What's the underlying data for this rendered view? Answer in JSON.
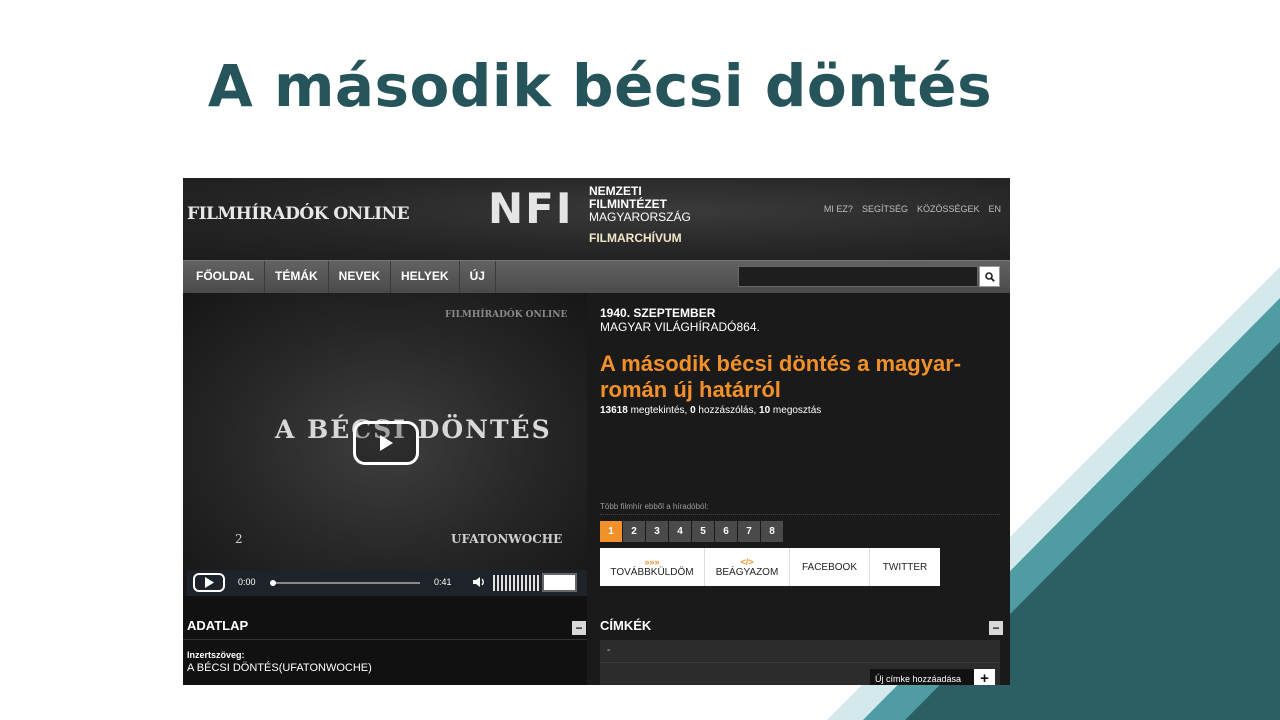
{
  "slide": {
    "title": "A második bécsi döntés"
  },
  "header": {
    "brand": "FILMHÍRADÓK ONLINE",
    "nfi_logo": "NFI",
    "nfi_line1": "NEMZETI",
    "nfi_line2": "FILMINTÉZET",
    "nfi_line3": "MAGYARORSZÁG",
    "nfi_line4": "FILMARCHÍVUM",
    "links": [
      "MI EZ?",
      "SEGÍTSÉG",
      "KÖZÖSSÉGEK",
      "EN"
    ]
  },
  "nav": {
    "items": [
      "FŐOLDAL",
      "TÉMÁK",
      "NEVEK",
      "HELYEK",
      "ÚJ"
    ],
    "search_placeholder": ""
  },
  "video": {
    "watermark": "FILMHÍRADÓK ONLINE",
    "frame_title": "A BÉCSI DÖNTÉS",
    "frame_number": "2",
    "frame_credit": "UFATONWOCHE",
    "time_current": "0:00",
    "time_total": "0:41",
    "progress": 0
  },
  "info": {
    "date": "1940. SZEPTEMBER",
    "newsreel": "MAGYAR VILÁGHÍRADÓ864.",
    "title": "A második bécsi döntés a magyar-román új határról",
    "views": "13618",
    "views_label": "megtekintés,",
    "comments": "0",
    "comments_label": "hozzászólás,",
    "shares": "10",
    "shares_label": "megosztás",
    "more_label": "Több filmhír ebből a híradóból:",
    "pages": [
      "1",
      "2",
      "3",
      "4",
      "5",
      "6",
      "7",
      "8"
    ],
    "active_page": "1",
    "share_buttons": {
      "forward": "TOVÁBBKÜLDÖM",
      "embed": "BEÁGYAZOM",
      "facebook": "FACEBOOK",
      "twitter": "TWITTER"
    },
    "accent_color": "#f2912a"
  },
  "adatlap": {
    "title": "ADATLAP",
    "label": "Inzertszöveg:",
    "value": "A BÉCSI DÖNTÉS(UFATONWOCHE)"
  },
  "cimkek": {
    "title": "CÍMKÉK",
    "tag": "-",
    "add_label": "Új címke hozzáadása"
  }
}
